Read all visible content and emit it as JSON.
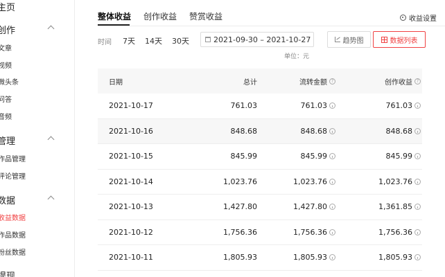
{
  "sidebar": {
    "home": "主页",
    "sections": [
      {
        "title": "创作",
        "items": [
          "文章",
          "视频",
          "微头条",
          "问答",
          "音频"
        ]
      },
      {
        "title": "管理",
        "items": [
          "作品管理",
          "评论管理"
        ]
      },
      {
        "title": "数据",
        "items": [
          "收益数据",
          "作品数据",
          "粉丝数据"
        ]
      }
    ],
    "withdraw": "提现",
    "active_item": "收益数据"
  },
  "tabs": [
    "整体收益",
    "创作收益",
    "赞赏收益"
  ],
  "settings_label": "收益设置",
  "filter": {
    "label": "时间",
    "options": [
      "7天",
      "14天",
      "30天"
    ],
    "date_range": "2021-09-30 – 2021-10-27"
  },
  "view_buttons": {
    "trend": "趋势图",
    "list": "数据列表"
  },
  "unit_text": "单位：元",
  "table": {
    "headers": [
      "日期",
      "总计",
      "流转金额",
      "创作收益"
    ],
    "rows": [
      [
        "2021-10-17",
        "761.03",
        "761.03",
        "761.03"
      ],
      [
        "2021-10-16",
        "848.68",
        "848.68",
        "848.68"
      ],
      [
        "2021-10-15",
        "845.99",
        "845.99",
        "845.99"
      ],
      [
        "2021-10-14",
        "1,023.76",
        "1,023.76",
        "1,023.76"
      ],
      [
        "2021-10-13",
        "1,427.80",
        "1,427.80",
        "1,361.85"
      ],
      [
        "2021-10-12",
        "1,756.36",
        "1,756.36",
        "1,756.36"
      ],
      [
        "2021-10-11",
        "1,805.93",
        "1,805.93",
        "1,805.93"
      ]
    ]
  },
  "colors": {
    "accent": "#f04142",
    "row_alt": "#f7f7f7"
  }
}
